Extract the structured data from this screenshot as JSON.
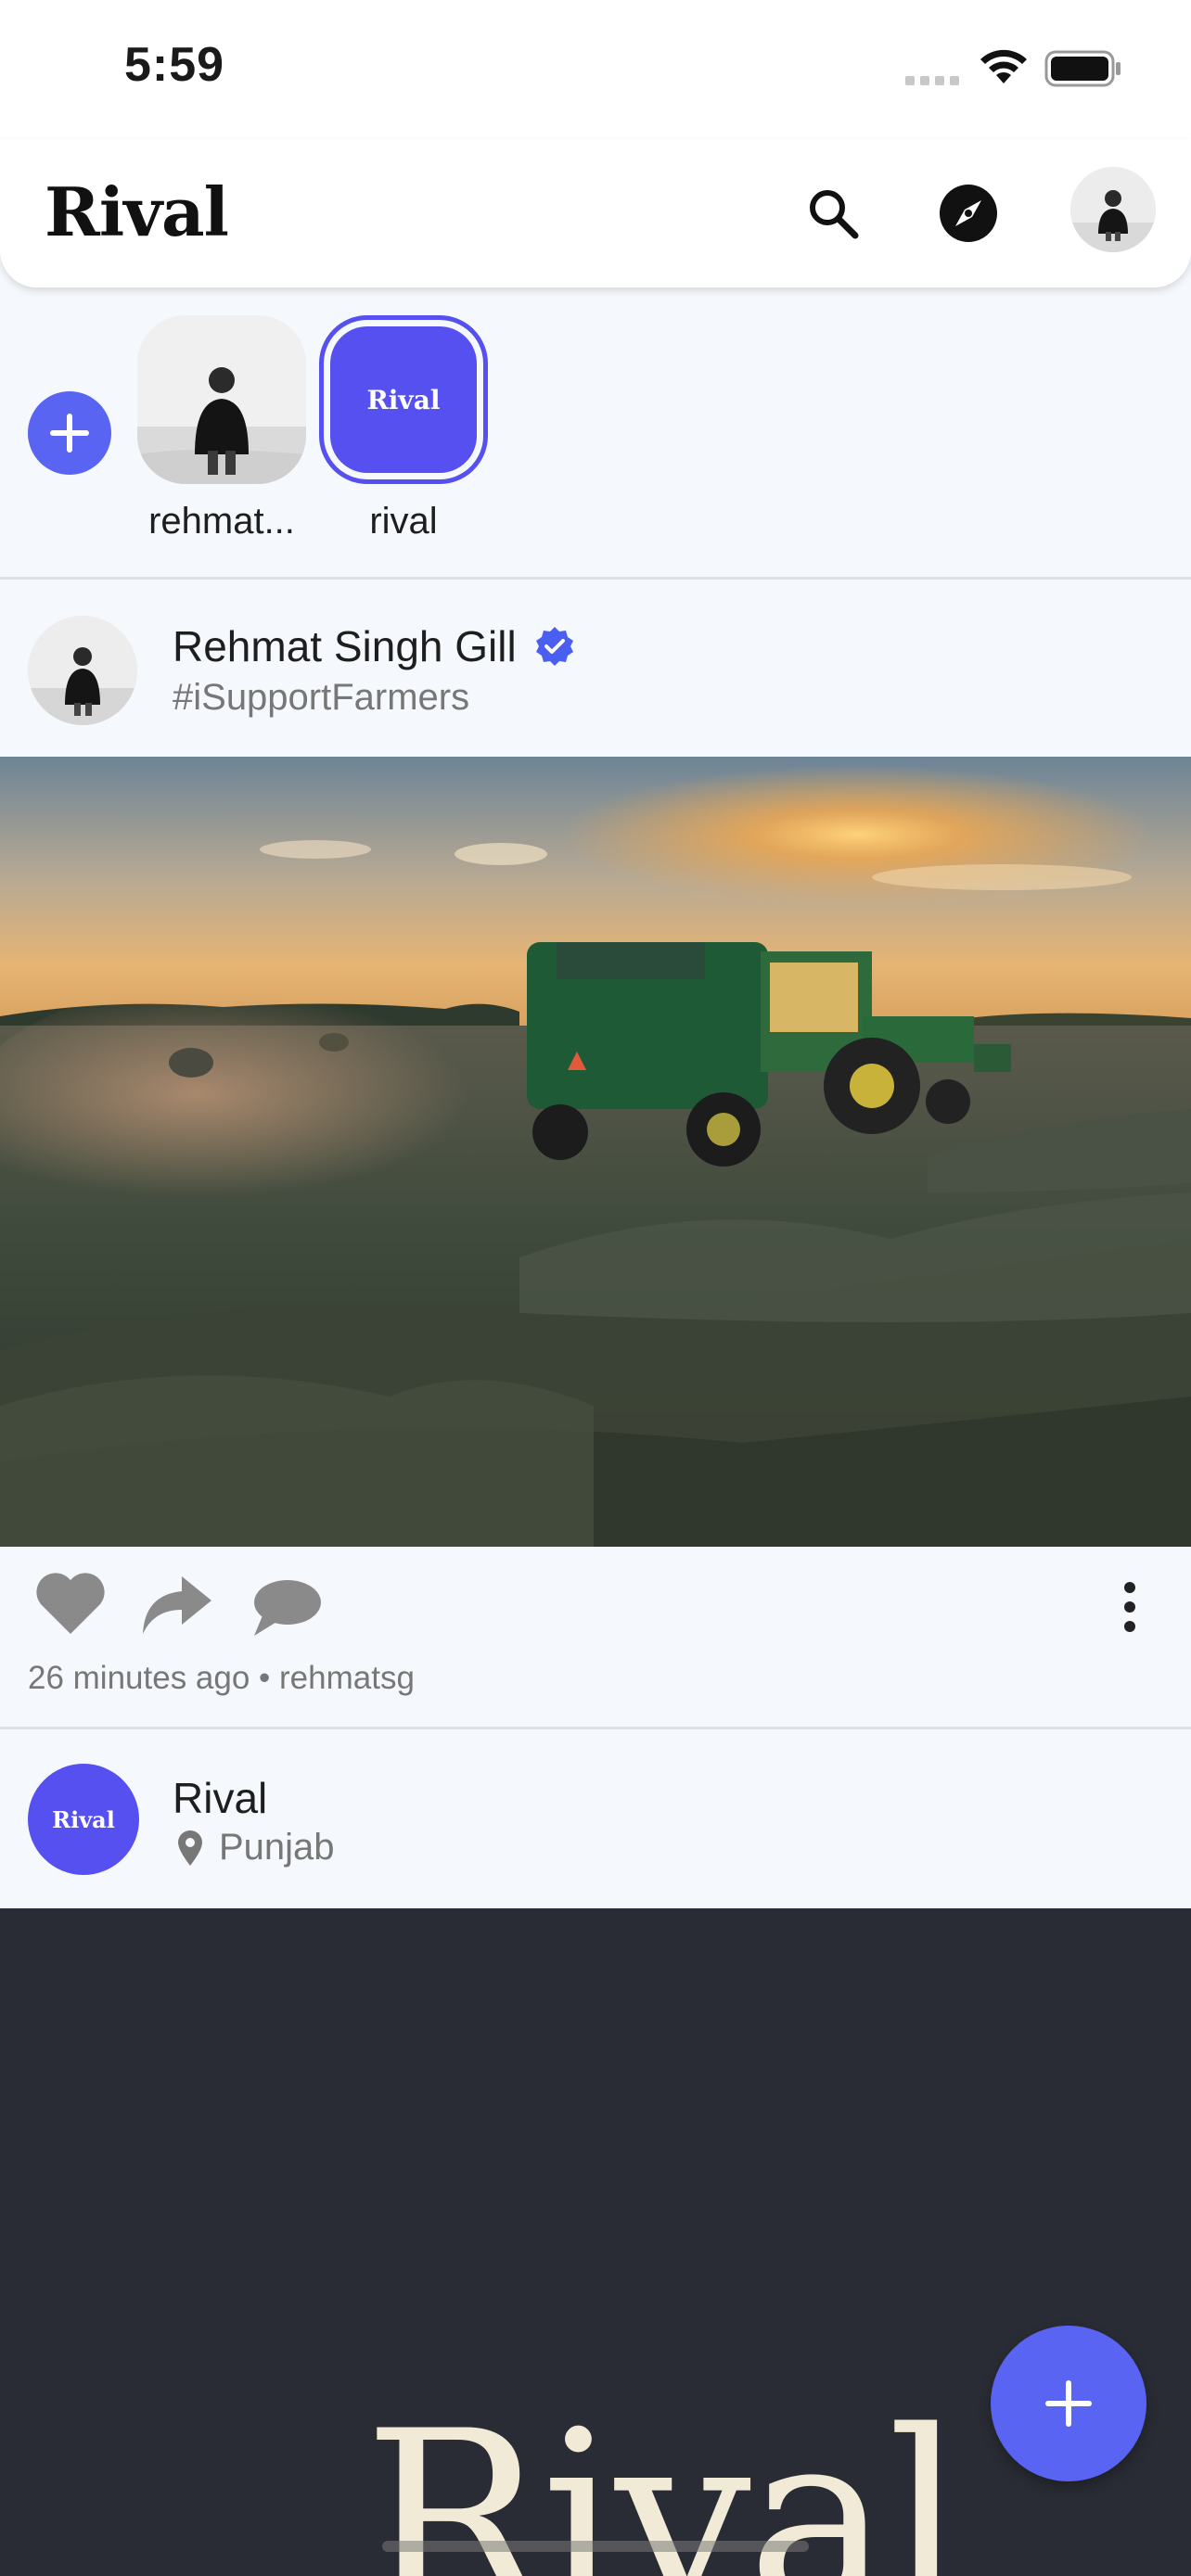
{
  "status_bar": {
    "time": "5:59"
  },
  "header": {
    "title": "Rival"
  },
  "stories": [
    {
      "label": "rehmat..."
    },
    {
      "label": "rival",
      "badge_text": "Rival"
    }
  ],
  "post": {
    "author": "Rehmat Singh Gill",
    "subtitle": "#iSupportFarmers",
    "meta": "26 minutes ago • rehmatsg"
  },
  "profile_row": {
    "avatar_text": "Rival",
    "name": "Rival",
    "location": "Punjab"
  },
  "dark_panel": {
    "logo": "Rival"
  },
  "colors": {
    "accent": "#5a64f2",
    "story_ring": "#5550ef",
    "verified": "#4a5ef0",
    "dark_panel": "#2a2c35"
  }
}
